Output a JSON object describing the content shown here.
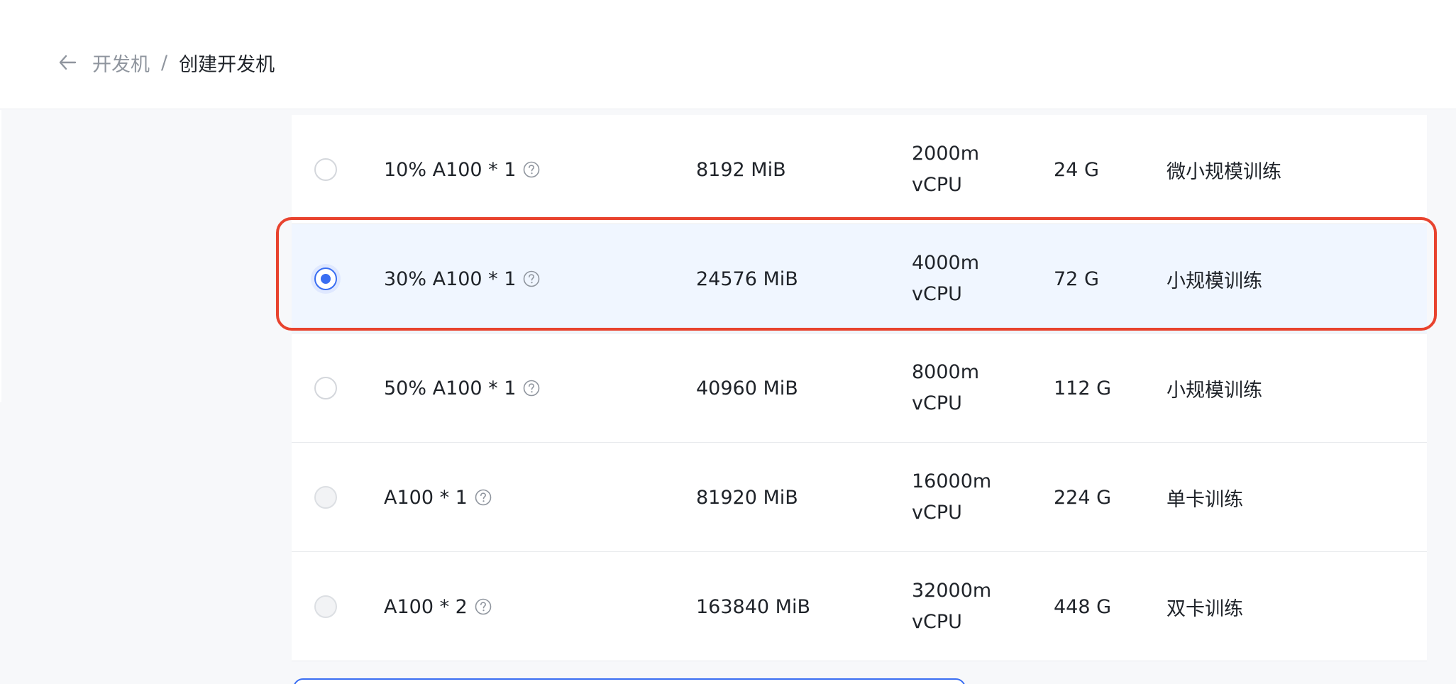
{
  "breadcrumb": {
    "parent": "开发机",
    "separator": "/",
    "current": "创建开发机"
  },
  "colors": {
    "accent": "#3a6ef2",
    "selected_row_bg": "#f0f6ff",
    "highlight_border": "#e8432e"
  },
  "rows": [
    {
      "spec": "10% A100 * 1",
      "memory": "8192 MiB",
      "cpu_line1": "2000m",
      "cpu_line2": "vCPU",
      "disk": "24 G",
      "scene": "微小规模训练",
      "selected": false,
      "disabled": false
    },
    {
      "spec": "30% A100 * 1",
      "memory": "24576 MiB",
      "cpu_line1": "4000m",
      "cpu_line2": "vCPU",
      "disk": "72 G",
      "scene": "小规模训练",
      "selected": true,
      "disabled": false
    },
    {
      "spec": "50% A100 * 1",
      "memory": "40960 MiB",
      "cpu_line1": "8000m",
      "cpu_line2": "vCPU",
      "disk": "112 G",
      "scene": "小规模训练",
      "selected": false,
      "disabled": false
    },
    {
      "spec": "A100 * 1",
      "memory": "81920 MiB",
      "cpu_line1": "16000m",
      "cpu_line2": "vCPU",
      "disk": "224 G",
      "scene": "单卡训练",
      "selected": false,
      "disabled": true
    },
    {
      "spec": "A100 * 2",
      "memory": "163840 MiB",
      "cpu_line1": "32000m",
      "cpu_line2": "vCPU",
      "disk": "448 G",
      "scene": "双卡训练",
      "selected": false,
      "disabled": true
    }
  ]
}
